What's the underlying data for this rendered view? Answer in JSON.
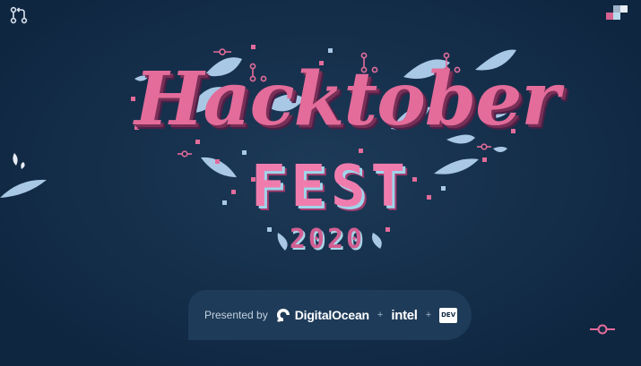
{
  "hero": {
    "title_line1": "Hacktober",
    "title_line2": "FEST",
    "year": "2020"
  },
  "sponsors": {
    "presented_by": "Presented by",
    "digitalocean": "DigitalOcean",
    "separator": "+",
    "intel": "intel",
    "dev": "DEV"
  },
  "colors": {
    "background": "#132b45",
    "pink": "#e36c9a",
    "light_blue": "#a8d7e8",
    "bar": "#1e3b59"
  },
  "icons": {
    "top_left": "git-pull-request-icon",
    "top_right": "pixel-squares-icon",
    "bottom_right": "git-commit-node-icon"
  }
}
